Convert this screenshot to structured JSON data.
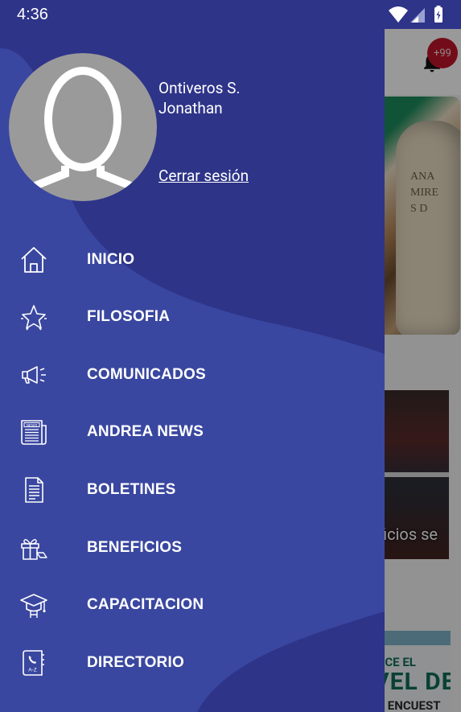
{
  "status_bar": {
    "time": "4:36"
  },
  "background_app": {
    "notification_count": "+99",
    "photo_caption": "ficios se",
    "banner": {
      "line1": "OCE EL",
      "line2": "VEL DE",
      "line3": "A ENCUEST"
    },
    "hero_text": "ANA\nMIRE\nS D"
  },
  "drawer": {
    "user_name": "Ontiveros S. Jonathan",
    "logout_label": "Cerrar sesión",
    "menu": [
      {
        "label": "INICIO",
        "icon": "home-icon"
      },
      {
        "label": "FILOSOFIA",
        "icon": "star-icon"
      },
      {
        "label": "COMUNICADOS",
        "icon": "megaphone-icon"
      },
      {
        "label": "ANDREA NEWS",
        "icon": "newspaper-icon"
      },
      {
        "label": "BOLETINES",
        "icon": "document-icon"
      },
      {
        "label": "BENEFICIOS",
        "icon": "gift-icon"
      },
      {
        "label": "CAPACITACION",
        "icon": "graduation-cap-icon"
      },
      {
        "label": "DIRECTORIO",
        "icon": "phone-book-icon"
      }
    ]
  },
  "colors": {
    "drawer_dark": "#2e3488",
    "drawer_light": "#3a47a0",
    "badge": "#c0152b"
  }
}
